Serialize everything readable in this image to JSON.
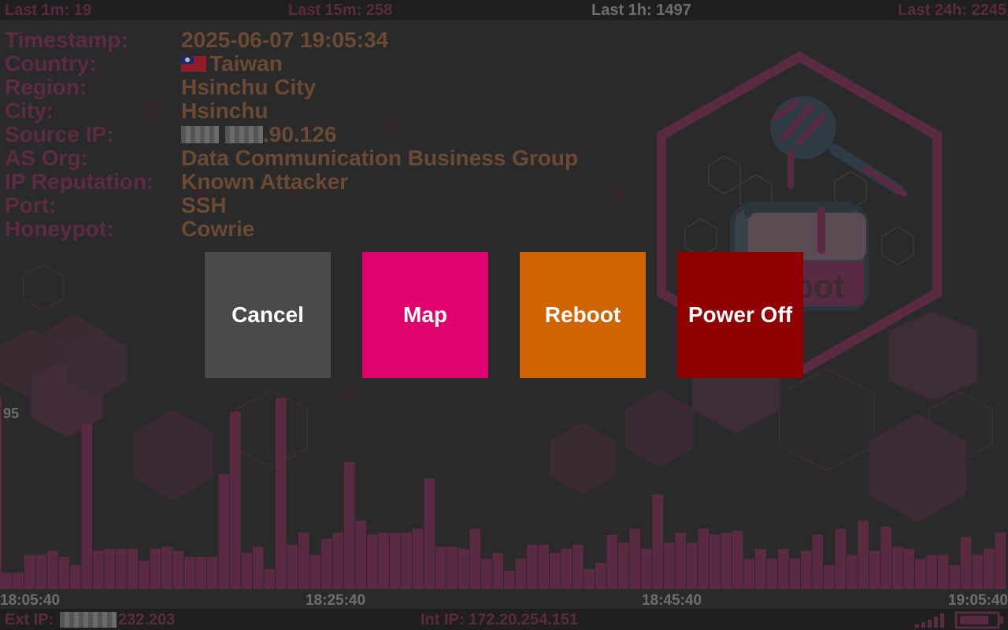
{
  "stats": {
    "last_1m": "Last 1m: 19",
    "last_15m": "Last 15m: 258",
    "last_1h": "Last 1h: 1497",
    "last_24h": "Last 24h: 2245"
  },
  "details": {
    "timestamp_label": "Timestamp:",
    "timestamp": "2025-06-07 19:05:34",
    "country_label": "Country:",
    "country": "Taiwan",
    "region_label": "Region:",
    "region": "Hsinchu City",
    "city_label": "City:",
    "city": "Hsinchu",
    "source_ip_label": "Source IP:",
    "source_ip_suffix": ".90.126",
    "as_org_label": "AS Org:",
    "as_org": "Data Communication Business Group",
    "reputation_label": "IP Reputation:",
    "reputation": "Known Attacker",
    "port_label": "Port:",
    "port": "SSH",
    "honeypot_label": "Honeypot:",
    "honeypot": "Cowrie"
  },
  "buttons": {
    "cancel": "Cancel",
    "map": "Map",
    "reboot": "Reboot",
    "power_off": "Power Off"
  },
  "colors": {
    "cancel": "#4a4a4a",
    "map": "#e0006e",
    "reboot": "#d06400",
    "power_off": "#900000",
    "bars": "#5a2a42"
  },
  "chart_data": {
    "type": "bar",
    "ymax_label": "95",
    "ylim": [
      0,
      95
    ],
    "x_tick_labels": [
      "18:05:40",
      "18:25:40",
      "18:45:40",
      "19:05:40"
    ],
    "values": [
      8,
      8,
      17,
      17,
      19,
      16,
      12,
      82,
      19,
      20,
      20,
      20,
      14,
      20,
      21,
      19,
      16,
      16,
      16,
      57,
      88,
      18,
      21,
      10,
      95,
      22,
      28,
      17,
      25,
      28,
      63,
      34,
      27,
      28,
      28,
      28,
      30,
      55,
      21,
      21,
      20,
      30,
      15,
      18,
      9,
      15,
      22,
      22,
      18,
      20,
      22,
      10,
      13,
      27,
      23,
      30,
      20,
      47,
      23,
      28,
      23,
      30,
      27,
      28,
      29,
      15,
      20,
      15,
      20,
      15,
      19,
      27,
      12,
      30,
      17,
      34,
      19,
      31,
      21,
      20,
      15,
      17,
      17,
      12,
      26,
      17,
      20,
      28
    ]
  },
  "footer": {
    "ext_ip_label": "Ext IP:",
    "ext_ip_suffix": "232.203",
    "int_ip": "Int IP: 172.20.254.151"
  },
  "icons": {
    "signal": "signal-bars-icon",
    "battery": "battery-icon",
    "logo": "honeypot-logo"
  }
}
